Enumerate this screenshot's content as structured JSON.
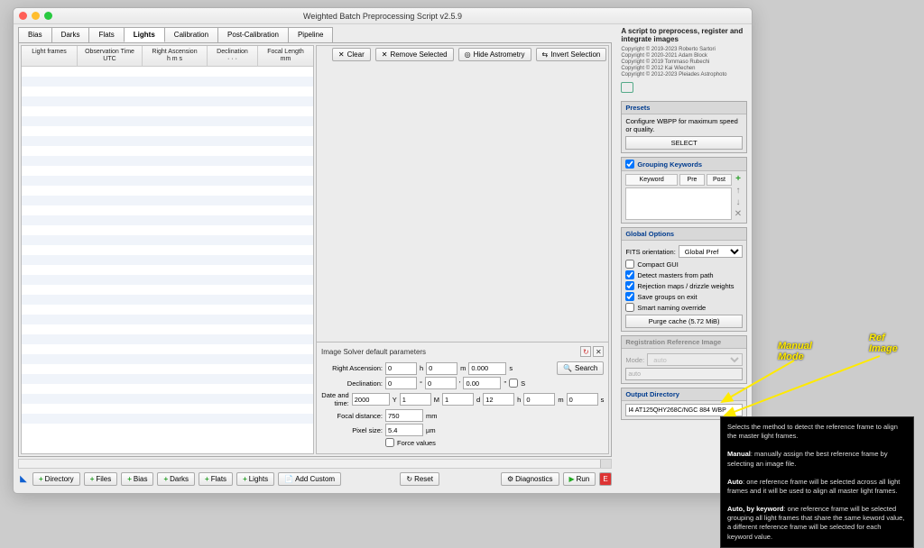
{
  "title": "Weighted Batch Preprocessing Script v2.5.9",
  "tabs": [
    "Bias",
    "Darks",
    "Flats",
    "Lights",
    "Calibration",
    "Post-Calibration",
    "Pipeline"
  ],
  "activeTab": "Lights",
  "columns": [
    "Light frames",
    "Observation Time\nUTC",
    "Right Ascension\nh   m   s",
    "Declination\n·   ·   ·",
    "Focal Length\nmm"
  ],
  "actions": {
    "clear": "Clear",
    "remove": "Remove Selected",
    "hide": "Hide Astrometry",
    "invert": "Invert Selection"
  },
  "solver": {
    "title": "Image Solver default parameters",
    "ra_label": "Right Ascension:",
    "ra_h": "0",
    "ra_m": "0",
    "ra_s": "0.000",
    "dec_label": "Declination:",
    "dec_d": "0",
    "dec_m": "0",
    "dec_s": "0.00",
    "dt_label": "Date and time:",
    "dt_y": "2000",
    "dt_M": "1",
    "dt_d": "1",
    "dt_h": "12",
    "dt_m2": "0",
    "dt_s": "0",
    "fl_label": "Focal distance:",
    "fl": "750",
    "fl_unit": "mm",
    "ps_label": "Pixel size:",
    "ps": "5.4",
    "ps_unit": "µm",
    "force": "Force values",
    "search": "Search"
  },
  "footer": {
    "dir": "Directory",
    "files": "Files",
    "bias": "Bias",
    "darks": "Darks",
    "flats": "Flats",
    "lights": "Lights",
    "custom": "Add Custom",
    "reset": "Reset",
    "diag": "Diagnostics",
    "run": "Run",
    "exit": "E"
  },
  "right": {
    "desc": "A script to preprocess, register and integrate images",
    "copy": "Copyright © 2019-2023 Roberto Sartori\nCopyright © 2020-2021 Adam Block\nCopyright © 2019 Tommaso Rubechi\nCopyright © 2012 Kai Wiechen\nCopyright © 2012-2023 Pleiades Astrophoto",
    "presets_h": "Presets",
    "presets_t": "Configure WBPP for maximum speed or quality.",
    "presets_b": "SELECT",
    "group_h": "Grouping Keywords",
    "kw": [
      "Keyword",
      "Pre",
      "Post"
    ],
    "global_h": "Global Options",
    "fits_l": "FITS orientation:",
    "fits_v": "Global Pref",
    "opt1": "Compact GUI",
    "opt2": "Detect masters from path",
    "opt3": "Rejection maps / drizzle weights",
    "opt4": "Save groups on exit",
    "opt5": "Smart naming override",
    "purge": "Purge cache (5.72 MiB)",
    "reg_h": "Registration Reference Image",
    "mode_l": "Mode:",
    "mode_v": "auto",
    "reg_in": "auto",
    "out_h": "Output Directory",
    "out_v": "I4 AT125QHY268C/NGC 884 WBP"
  },
  "anno": {
    "manual": "Manual\nMode",
    "ref": "Ref\nImage"
  },
  "tooltip": {
    "l1": "Selects the method to detect the reference frame to align the master light frames.",
    "l2b": "Manual",
    "l2": ": manually assign the best reference frame by selecting an image file.",
    "l3b": "Auto",
    "l3": ": one reference frame will be selected across all light frames and it will be used to align all master light frames.",
    "l4b": "Auto, by keyword",
    "l4": ": one reference frame will be selected grouping all light frames that share the same keword value, a different reference frame will be selected for each keyword value."
  }
}
